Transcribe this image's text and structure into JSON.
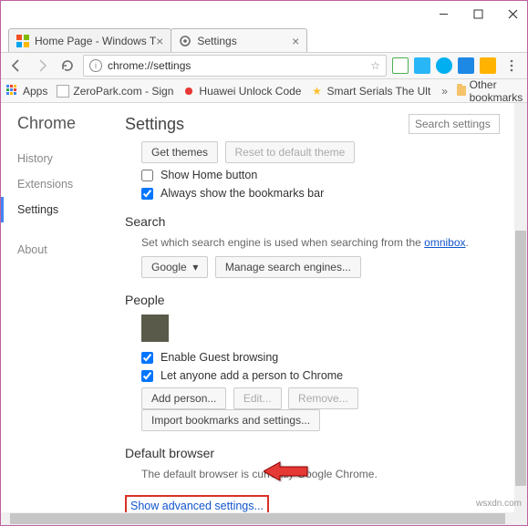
{
  "window": {
    "title": ""
  },
  "tabs": [
    {
      "label": "Home Page - Windows T"
    },
    {
      "label": "Settings"
    }
  ],
  "omnibox": {
    "url": "chrome://settings"
  },
  "bookmarks_bar": {
    "apps": "Apps",
    "items": [
      "ZeroPark.com - Sign",
      "Huawei Unlock Code",
      "Smart Serials The Ult"
    ],
    "other": "Other bookmarks"
  },
  "sidebar": {
    "title": "Chrome",
    "items": [
      "History",
      "Extensions",
      "Settings"
    ],
    "about": "About"
  },
  "main": {
    "title": "Settings",
    "search_placeholder": "Search settings",
    "appearance": {
      "get_themes": "Get themes",
      "reset_theme": "Reset to default theme",
      "show_home": "Show Home button",
      "show_bookmarks": "Always show the bookmarks bar"
    },
    "search": {
      "heading": "Search",
      "desc_pre": "Set which search engine is used when searching from the ",
      "desc_link": "omnibox",
      "engine": "Google",
      "manage": "Manage search engines..."
    },
    "people": {
      "heading": "People",
      "guest": "Enable Guest browsing",
      "anyone": "Let anyone add a person to Chrome",
      "add": "Add person...",
      "edit": "Edit...",
      "remove": "Remove...",
      "import": "Import bookmarks and settings..."
    },
    "default_browser": {
      "heading": "Default browser",
      "desc": "The default browser is currently Google Chrome."
    },
    "advanced": "Show advanced settings..."
  },
  "watermark": "wsxdn.com"
}
